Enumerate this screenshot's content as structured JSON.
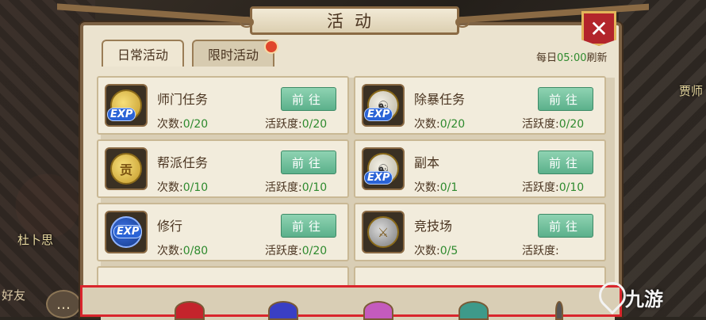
{
  "scene": {
    "npc_left": "杜卜思",
    "npc_right": "贾师",
    "friend_label": "好友"
  },
  "header": {
    "title": "活动",
    "close": "✕"
  },
  "tabs": [
    {
      "label": "日常活动",
      "active": true
    },
    {
      "label": "限时活动",
      "active": false,
      "badge": true
    }
  ],
  "refresh": {
    "prefix": "每日",
    "time": "05:00",
    "suffix": "刷新"
  },
  "tasks": [
    {
      "name": "师门任务",
      "icon": "exp-coin-icon",
      "count_label": "次数:",
      "count": "0/20",
      "active_label": "活跃度:",
      "active": "0/20",
      "button": "前往"
    },
    {
      "name": "除暴任务",
      "icon": "exp-taiji-icon",
      "count_label": "次数:",
      "count": "0/20",
      "active_label": "活跃度:",
      "active": "0/20",
      "button": "前往"
    },
    {
      "name": "帮派任务",
      "icon": "gong-coin-icon",
      "count_label": "次数:",
      "count": "0/10",
      "active_label": "活跃度:",
      "active": "0/10",
      "button": "前往"
    },
    {
      "name": "副本",
      "icon": "exp-taiji-icon",
      "count_label": "次数:",
      "count": "0/1",
      "active_label": "活跃度:",
      "active": "0/10",
      "button": "前往"
    },
    {
      "name": "修行",
      "icon": "exp-blue-icon",
      "count_label": "次数:",
      "count": "0/80",
      "active_label": "活跃度:",
      "active": "0/20",
      "button": "前往"
    },
    {
      "name": "竞技场",
      "icon": "crossed-swords-icon",
      "count_label": "次数:",
      "count": "0/5",
      "active_label": "活跃度:",
      "active": "",
      "button": "前往"
    }
  ],
  "coin_glyph": "贡",
  "exp_text": "EXP",
  "watermark": "九游",
  "colors": {
    "accent_green": "#2e8a2e",
    "button_green": "#5bb08b",
    "close_red": "#b3252b",
    "highlight_red": "#d9252c"
  }
}
